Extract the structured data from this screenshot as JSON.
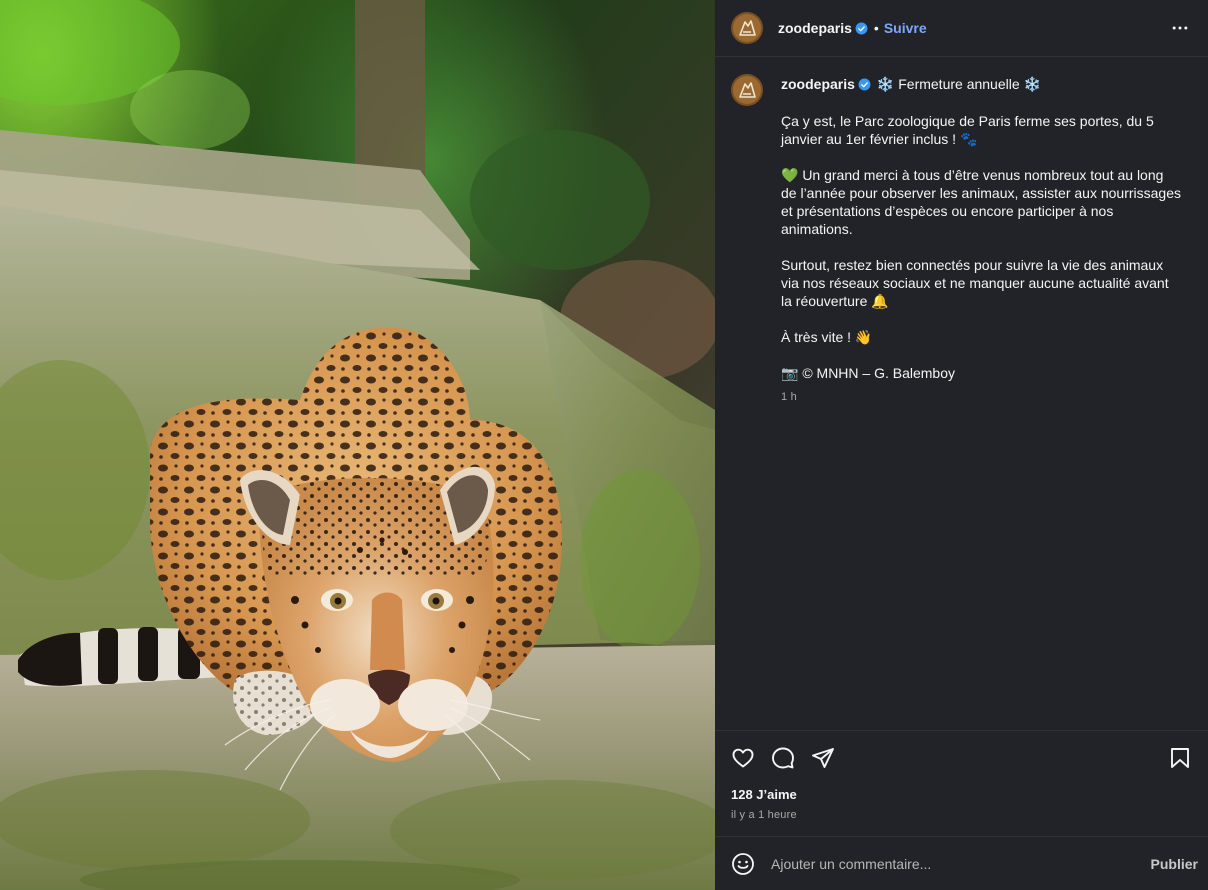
{
  "header": {
    "username": "zoodeparis",
    "separator": "•",
    "follow_label": "Suivre",
    "verified_icon": "verified-badge-icon",
    "more_icon": "more-options-icon"
  },
  "caption": {
    "username": "zoodeparis",
    "title_emoji_left": "❄️",
    "title": "Fermeture annuelle",
    "title_emoji_right": "❄️",
    "paragraphs": [
      "Ça y est, le Parc zoologique de Paris ferme ses portes, du 5 janvier au 1er février inclus ! 🐾",
      "💚 Un grand merci à tous d’être venus nombreux tout au long de l’année pour observer les animaux, assister aux nourrissages et présentations d’espèces ou encore participer à nos animations.",
      "Surtout, restez bien connectés pour suivre la vie des animaux via nos réseaux sociaux et ne manquer aucune actualité avant la réouverture 🔔",
      "À très vite ! 👋",
      "📷 © MNHN – G. Balemboy"
    ],
    "timestamp": "1 h"
  },
  "actions": {
    "like_icon": "heart-icon",
    "comment_icon": "comment-icon",
    "share_icon": "send-icon",
    "save_icon": "bookmark-icon",
    "likes": "128 J’aime",
    "posted_ago": "il y a 1 heure"
  },
  "comment": {
    "placeholder": "Ajouter un commentaire...",
    "publish_label": "Publier",
    "emoji_icon": "smiley-icon"
  },
  "colors": {
    "panel_bg": "#212328",
    "link_blue": "#7fa6ff",
    "verified_blue": "#3897f0"
  }
}
